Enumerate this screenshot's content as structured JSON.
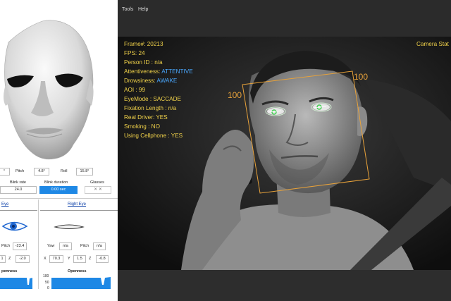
{
  "menu": {
    "tools": "Tools",
    "help": "Help"
  },
  "head_pose": {
    "yaw_value": "°",
    "pitch_label": "Pitch",
    "pitch_value": "4.8°",
    "roll_label": "Roll",
    "roll_value": "15.8°"
  },
  "blink": {
    "rate_label": "Blink rate",
    "rate_value": "24.0",
    "duration_label": "Blink duration",
    "duration_value": "0.00 sec",
    "glasses_label": "Glasses"
  },
  "eyes": {
    "left_tab": "Eye",
    "right_tab": "Right Eye",
    "left_pitch_label": "Pitch",
    "left_pitch_value": "-23.4",
    "left_x_value": "1",
    "left_z_label": "Z",
    "left_z_value": "-2.0",
    "right_yaw_label": "Yaw",
    "right_yaw_value": "n/a",
    "right_pitch_label": "Pitch",
    "right_pitch_value": "n/a",
    "right_x_label": "X",
    "right_x_value": "70.3",
    "right_y_label": "Y",
    "right_y_value": "1.5",
    "right_z_label": "Z",
    "right_z_value": "-0.8",
    "left_openness_label": "penness",
    "right_openness_label": "Openness",
    "axis_100": "100",
    "axis_50": "50",
    "axis_0": "0"
  },
  "overlay": {
    "frame": "Frame#:  20213",
    "fps": "FPS:  24",
    "person": "Person ID : n/a",
    "attentive_label": "Attentiveness:",
    "attentive_value": "ATTENTIVE",
    "drowsy_label": "Drowsiness:",
    "drowsy_value": "AWAKE",
    "aoi": "AOI : 99",
    "eyemode": "EyeMode : SACCADE",
    "fixation": "Fixation Length : n/a",
    "real_driver": "Real Driver: YES",
    "smoking": "Smoking : NO",
    "cellphone": "Using Cellphone : YES",
    "camera_status": "Camera Stat",
    "box_label_left": "100",
    "box_label_right": "100"
  },
  "colors": {
    "accent_blue": "#1e88e5",
    "overlay_yellow": "#f2d34a",
    "box_orange": "#e8a23a"
  }
}
